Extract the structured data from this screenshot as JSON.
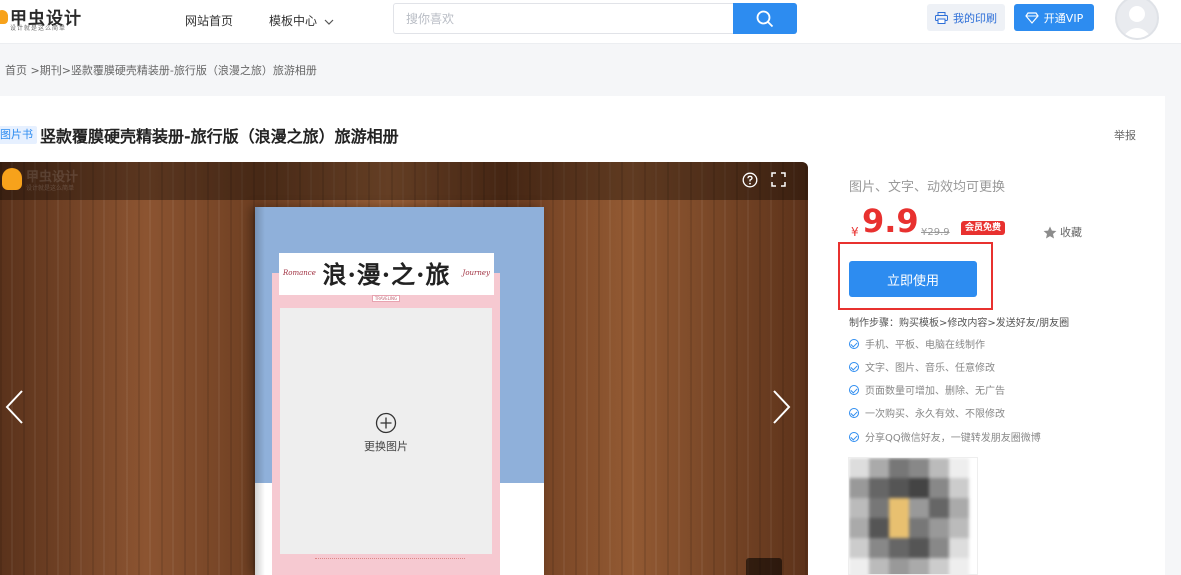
{
  "header": {
    "logo_text": "甲虫设计",
    "logo_subtitle": "设计就是这么简单",
    "nav": [
      {
        "label": "网站首页"
      },
      {
        "label": "模板中心"
      }
    ],
    "search_placeholder": "搜你喜欢",
    "print_label": "我的印刷",
    "vip_label": "开通VIP"
  },
  "breadcrumb": {
    "home": "首页",
    "sep1": " >",
    "category": "期刊",
    "sep2": ">",
    "current": "竖款覆膜硬壳精装册-旅行版（浪漫之旅）旅游相册"
  },
  "product": {
    "type_badge": "图片书",
    "title": "竖款覆膜硬壳精装册-旅行版（浪漫之旅）旅游相册",
    "report_label": "举报",
    "subtitle": "图片、文字、动效均可更换",
    "currency": "¥",
    "price": "9.9",
    "old_price": "¥29.9",
    "member_badge": "会员免费",
    "favorite_label": "收藏",
    "use_button": "立即使用",
    "steps": "制作步骤：购买模板>修改内容>发送好友/朋友圈",
    "features": [
      "手机、平板、电脑在线制作",
      "文字、图片、音乐、任意修改",
      "页面数量可增加、删除、无广告",
      "一次购买、永久有效、不限修改",
      "分享QQ微信好友，一键转发朋友圈微博"
    ]
  },
  "preview": {
    "watermark_text": "甲虫设计",
    "watermark_subtitle": "设计就是这么简单",
    "cover_title": "浪·漫·之·旅",
    "script_left": "Romance",
    "script_right": "Journey",
    "small_label": "TRAVELING",
    "photo_label": "更换图片"
  },
  "colors": {
    "accent": "#2d8cf0",
    "price": "#e8312f",
    "card_pink": "#f6c9d1",
    "book_blue": "#8fb0da"
  },
  "icons": {
    "search": "search-icon",
    "print": "printer-icon",
    "vip": "diamond-icon",
    "help": "help-icon",
    "fullscreen": "fullscreen-icon",
    "prev": "chevron-left-icon",
    "next": "chevron-right-icon",
    "star": "star-icon",
    "check": "check-circle-icon",
    "add": "plus-circle-icon"
  }
}
